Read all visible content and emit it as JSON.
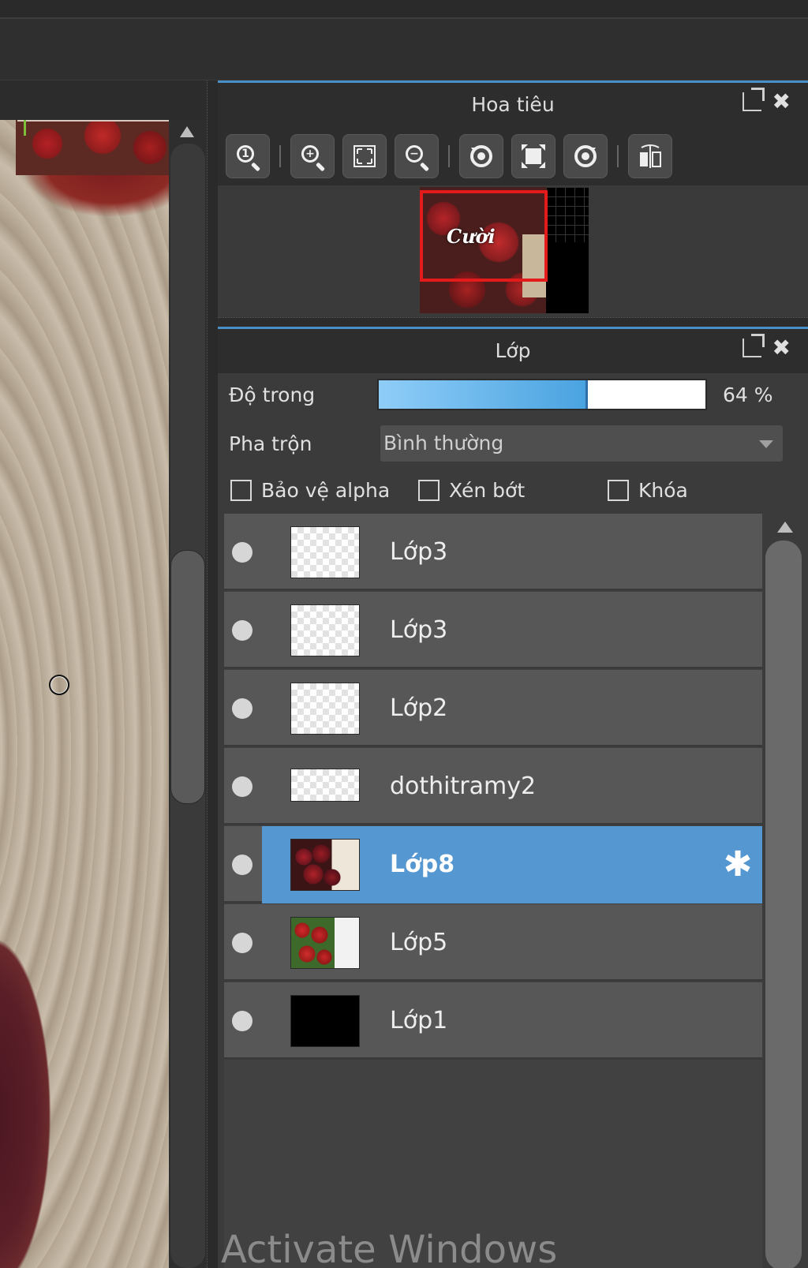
{
  "navigator": {
    "title": "Hoa tiêu",
    "toolbar": {
      "zoom_actual_icon": "zoom-actual-icon",
      "zoom_in_icon": "zoom-in-icon",
      "fit_icon": "fit-screen-icon",
      "zoom_out_icon": "zoom-out-icon",
      "rotate_left_icon": "rotate-left-icon",
      "full_icon": "full-view-icon",
      "rotate_right_icon": "rotate-right-icon",
      "flip_icon": "flip-icon"
    },
    "preview_logo_text": "Cười"
  },
  "layers": {
    "title": "Lớp",
    "opacity_label": "Độ trong",
    "opacity_value": "64 %",
    "opacity_fraction": 0.64,
    "blend_label": "Pha trộn",
    "blend_value": "Bình thường",
    "checkbox_alpha": "Bảo vệ alpha",
    "checkbox_clip": "Xén bớt",
    "checkbox_lock": "Khóa",
    "items": [
      {
        "name": "Lớp3"
      },
      {
        "name": "Lớp3"
      },
      {
        "name": "Lớp2"
      },
      {
        "name": "dothitramy2"
      },
      {
        "name": "Lớp8",
        "selected": true
      },
      {
        "name": "Lớp5"
      },
      {
        "name": "Lớp1"
      }
    ]
  },
  "watermark": "Activate Windows",
  "colors": {
    "accent": "#4a90c7",
    "selected_row": "#5597d1"
  }
}
